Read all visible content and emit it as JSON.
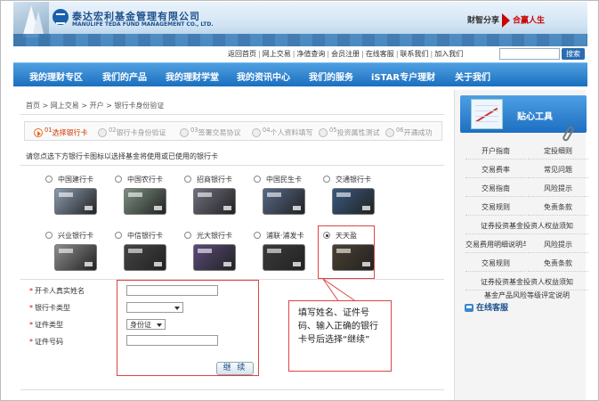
{
  "header": {
    "company_cn": "泰达宏利基金管理有限公司",
    "company_en": "MANULIFE TEDA FUND MANAGEMENT CO., LTD.",
    "slogan_left": "财智分享",
    "slogan_right": "合赢人生"
  },
  "toplinks": [
    "返回首页",
    "网上交易",
    "净值查询",
    "会员注册",
    "在线客服",
    "联系我们",
    "加入我们"
  ],
  "search": {
    "button": "搜索",
    "value": ""
  },
  "nav": [
    "我的理财专区",
    "我们的产品",
    "我的理财学堂",
    "我的资讯中心",
    "我们的服务",
    "iSTAR专户理财",
    "关于我们"
  ],
  "breadcrumb": "首页 > 网上交易 > 开户 > 银行卡身份验证",
  "steps": [
    "选择银行卡",
    "银行卡身份验证",
    "签署交易协议",
    "个人资料填写",
    "投资属性测试",
    "开通成功"
  ],
  "step_numbers": [
    "01",
    "02",
    "03",
    "04",
    "05",
    "06"
  ],
  "instruction": "请您点选下方银行卡图标以选择基金将使用或已使用的银行卡",
  "banks": [
    {
      "name": "中国建行卡",
      "color": "#8a9bb0"
    },
    {
      "name": "中国农行卡",
      "color": "#7b8f7f"
    },
    {
      "name": "招商银行卡",
      "color": "#6f6f80"
    },
    {
      "name": "中国民生卡",
      "color": "#55698a"
    },
    {
      "name": "交通银行卡",
      "color": "#3a5a80"
    },
    {
      "name": "兴业银行卡",
      "color": "#8c8c8c"
    },
    {
      "name": "中信银行卡",
      "color": "#444444"
    },
    {
      "name": "光大银行卡",
      "color": "#5a4a7a"
    },
    {
      "name": "浦联·浦发卡",
      "color": "#3a3a3a"
    },
    {
      "name": "天天盈",
      "color": "#4a4030"
    }
  ],
  "selected_bank": "天天盈",
  "form": {
    "name_label": "开卡人真实姓名",
    "cardtype_label": "银行卡类型",
    "idtype_label": "证件类型",
    "idtype_value": "身份证",
    "idnum_label": "证件号码",
    "continue": "继 续"
  },
  "callout": "填写姓名、证件号码、输入正确的银行卡号后选择“继续”",
  "sidebar": {
    "title": "贴心工具",
    "rows": [
      [
        "开户指南",
        "定投细则"
      ],
      [
        "交易费率",
        "常见问题"
      ],
      [
        "交易指南",
        "风险提示"
      ],
      [
        "交易规则",
        "免责条款"
      ],
      [
        "证券投资基金投资人权益须知"
      ],
      [
        "交易费用明细说明与计算方式",
        "风险提示"
      ],
      [
        "交易规则",
        "免责条款"
      ],
      [
        "证券投资基金投资人权益须知"
      ],
      [
        "基金产品风险等级评定说明"
      ]
    ],
    "online": "在线客服"
  }
}
